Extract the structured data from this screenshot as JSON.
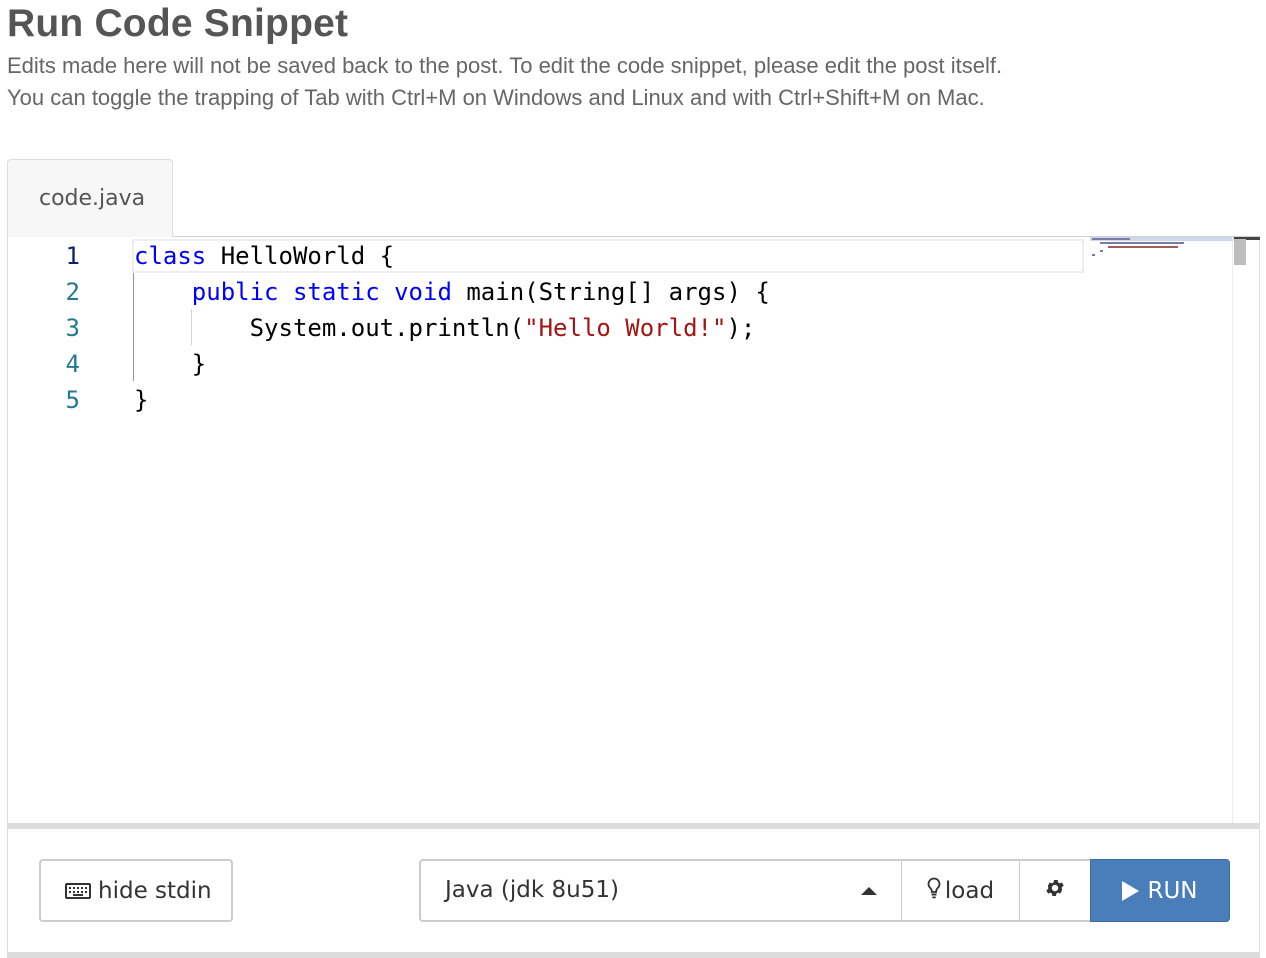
{
  "header": {
    "title": "Run Code Snippet",
    "description_lines": [
      "Edits made here will not be saved back to the post. To edit the code snippet, please edit the post itself.",
      "You can toggle the trapping of Tab with Ctrl+M on Windows and Linux and with Ctrl+Shift+M on Mac."
    ]
  },
  "tabs": [
    {
      "label": "code.java",
      "active": true
    }
  ],
  "editor": {
    "line_numbers": [
      "1",
      "2",
      "3",
      "4",
      "5"
    ],
    "lines": [
      [
        {
          "t": "class",
          "k": "kw"
        },
        {
          "t": " HelloWorld {",
          "k": ""
        }
      ],
      [
        {
          "t": "    ",
          "k": ""
        },
        {
          "t": "public",
          "k": "kw"
        },
        {
          "t": " ",
          "k": ""
        },
        {
          "t": "static",
          "k": "kw"
        },
        {
          "t": " ",
          "k": ""
        },
        {
          "t": "void",
          "k": "kw"
        },
        {
          "t": " main(String[] args) {",
          "k": ""
        }
      ],
      [
        {
          "t": "        System.out.println(",
          "k": ""
        },
        {
          "t": "\"Hello World!\"",
          "k": "str"
        },
        {
          "t": ");",
          "k": ""
        }
      ],
      [
        {
          "t": "    }",
          "k": ""
        }
      ],
      [
        {
          "t": "}",
          "k": ""
        }
      ]
    ],
    "colors": {
      "keyword": "#0000ff",
      "string": "#a31515",
      "line_number": "#237893"
    }
  },
  "toolbar": {
    "stdin_label": "hide stdin",
    "language_value": "Java (jdk 8u51)",
    "load_label": "load",
    "run_label": "RUN",
    "run_color": "#4a7ebb"
  },
  "icons": {
    "stdin": "keyboard-icon",
    "load": "lightbulb-icon",
    "settings": "gear-icon",
    "run": "play-icon",
    "select": "caret-up-icon"
  }
}
